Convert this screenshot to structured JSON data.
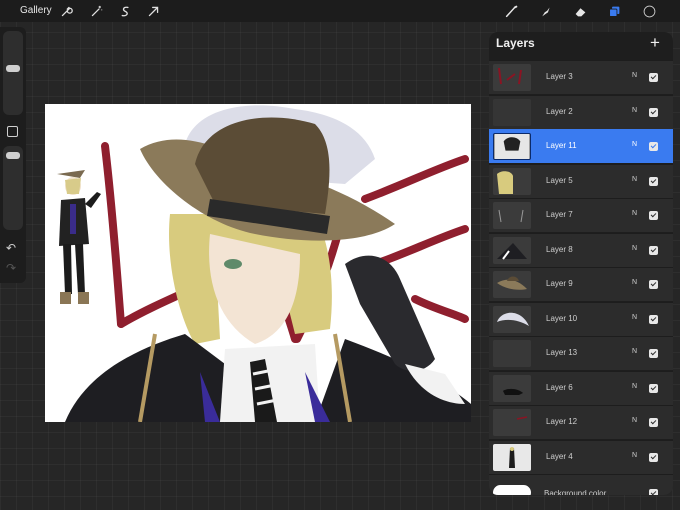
{
  "toolbar": {
    "gallery_label": "Gallery",
    "left_tools": [
      "wrench-icon",
      "magic-wand-icon",
      "selection-icon",
      "transform-arrow-icon"
    ],
    "right_tools": [
      "brush-icon",
      "smudge-icon",
      "eraser-icon",
      "layers-icon",
      "color-swatch"
    ],
    "accent_color": "#3a7bf0",
    "active_color": "#1a1a1a"
  },
  "sidebar": {
    "brush_size_level": 0.5,
    "opacity_level": 0.5,
    "undo_icon": "undo-icon",
    "redo_icon": "redo-icon"
  },
  "layers_panel": {
    "title": "Layers",
    "add_icon": "plus-icon",
    "layers": [
      {
        "name": "Layer 3",
        "blend": "N",
        "visible": true,
        "selected": false
      },
      {
        "name": "Layer 2",
        "blend": "N",
        "visible": true,
        "selected": false
      },
      {
        "name": "Layer 11",
        "blend": "N",
        "visible": true,
        "selected": true
      },
      {
        "name": "Layer 5",
        "blend": "N",
        "visible": true,
        "selected": false
      },
      {
        "name": "Layer 7",
        "blend": "N",
        "visible": true,
        "selected": false
      },
      {
        "name": "Layer 8",
        "blend": "N",
        "visible": true,
        "selected": false
      },
      {
        "name": "Layer 9",
        "blend": "N",
        "visible": true,
        "selected": false
      },
      {
        "name": "Layer 10",
        "blend": "N",
        "visible": true,
        "selected": false
      },
      {
        "name": "Layer 13",
        "blend": "N",
        "visible": true,
        "selected": false
      },
      {
        "name": "Layer 6",
        "blend": "N",
        "visible": true,
        "selected": false
      },
      {
        "name": "Layer 12",
        "blend": "N",
        "visible": true,
        "selected": false
      },
      {
        "name": "Layer 4",
        "blend": "N",
        "visible": true,
        "selected": false
      }
    ],
    "background_label": "Background color",
    "background_visible": true
  }
}
